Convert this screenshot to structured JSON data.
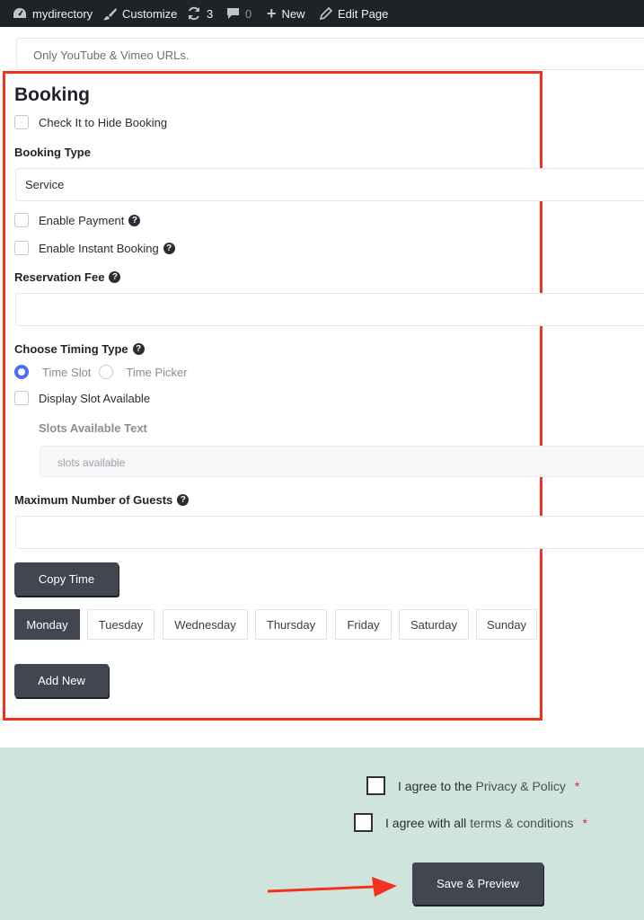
{
  "adminbar": {
    "site_name": "mydirectory",
    "customize": "Customize",
    "updates_count": "3",
    "comments_count": "0",
    "new_label": "New",
    "edit_page": "Edit Page"
  },
  "video": {
    "placeholder": "Only YouTube & Vimeo URLs."
  },
  "booking": {
    "title": "Booking",
    "hide_label": "Check It to Hide Booking",
    "type_label": "Booking Type",
    "type_value": "Service",
    "enable_payment": "Enable Payment",
    "instant_booking": "Enable Instant Booking",
    "fee_label": "Reservation Fee",
    "fee_value": "",
    "timing_label": "Choose Timing Type",
    "timing_options": [
      "Time Slot",
      "Time Picker"
    ],
    "timing_selected": "Time Slot",
    "display_slot": "Display Slot Available",
    "slots_text_label": "Slots Available Text",
    "slots_text_placeholder": "slots available",
    "guests_label": "Maximum Number of Guests",
    "guests_value": "",
    "copy_time": "Copy Time",
    "days": [
      "Monday",
      "Tuesday",
      "Wednesday",
      "Thursday",
      "Friday",
      "Saturday",
      "Sunday"
    ],
    "active_day": "Monday",
    "add_new": "Add New"
  },
  "agreements": {
    "privacy_prefix": "I agree to the",
    "privacy_link": "Privacy & Policy",
    "terms_prefix": "I agree with all",
    "terms_link": "terms & conditions",
    "required_mark": "*"
  },
  "save_preview": "Save & Preview",
  "colors": {
    "highlight_border": "#f0321e",
    "radio_accent": "#4e6cf5",
    "button_dark": "#42474f",
    "footer_band": "#cfe4dd",
    "required": "#e1262b",
    "adminbar_bg": "#1d2327"
  }
}
